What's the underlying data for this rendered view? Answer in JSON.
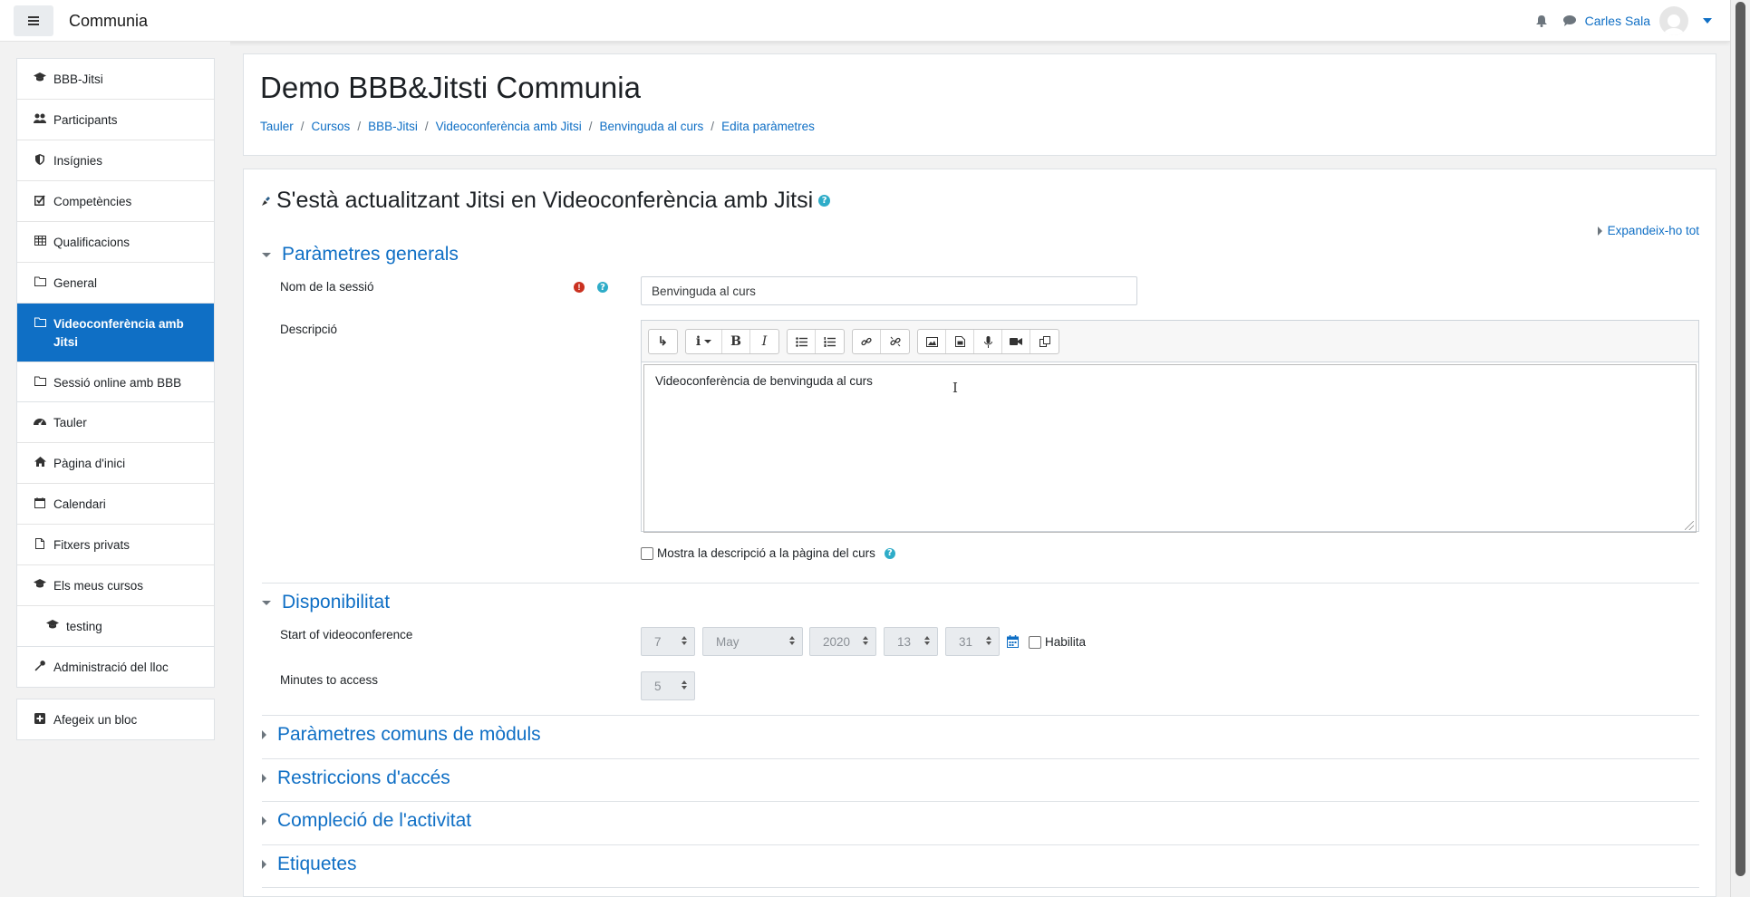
{
  "navbar": {
    "brand": "Communia",
    "user_name": "Carles Sala"
  },
  "drawer": {
    "course_nav": [
      {
        "label": "BBB-Jitsi",
        "icon": "graduation-cap-icon"
      },
      {
        "label": "Participants",
        "icon": "users-icon"
      },
      {
        "label": "Insígnies",
        "icon": "shield-icon"
      },
      {
        "label": "Competències",
        "icon": "checkbox-icon"
      },
      {
        "label": "Qualificacions",
        "icon": "table-icon"
      },
      {
        "label": "General",
        "icon": "folder-icon"
      },
      {
        "label": "Videoconferència amb Jitsi",
        "icon": "folder-icon",
        "active": true
      },
      {
        "label": "Sessió online amb BBB",
        "icon": "folder-icon"
      }
    ],
    "site_nav": [
      {
        "label": "Tauler",
        "icon": "dashboard-icon"
      },
      {
        "label": "Pàgina d'inici",
        "icon": "home-icon"
      },
      {
        "label": "Calendari",
        "icon": "calendar-icon"
      },
      {
        "label": "Fitxers privats",
        "icon": "file-icon"
      },
      {
        "label": "Els meus cursos",
        "icon": "graduation-cap-icon"
      },
      {
        "label": "testing",
        "icon": "graduation-cap-icon"
      }
    ],
    "admin": {
      "label": "Administració del lloc"
    },
    "add_block": {
      "label": "Afegeix un bloc"
    }
  },
  "header": {
    "title": "Demo BBB&Jitsti Communia",
    "breadcrumb": [
      "Tauler",
      "Cursos",
      "BBB-Jitsi",
      "Videoconferència amb Jitsi",
      "Benvinguda al curs",
      "Edita paràmetres"
    ]
  },
  "form": {
    "title": "S'està actualitzant Jitsi en Videoconferència amb Jitsi",
    "expand_all": "Expandeix-ho tot",
    "general": {
      "heading": "Paràmetres generals",
      "name_label": "Nom de la sessió",
      "name_value": "Benvinguda al curs",
      "desc_label": "Descripció",
      "desc_value": "Videoconferència de benvinguda al curs",
      "show_desc_label": "Mostra la descripció a la pàgina del curs"
    },
    "availability": {
      "heading": "Disponibilitat",
      "start_label": "Start of videoconference",
      "day": "7",
      "month": "May",
      "year": "2020",
      "hour": "13",
      "minute": "31",
      "enable_label": "Habilita",
      "minutes_label": "Minutes to access",
      "minutes_value": "5"
    },
    "collapsed_sections": [
      "Paràmetres comuns de mòduls",
      "Restriccions d'accés",
      "Compleció de l'activitat",
      "Etiquetes"
    ]
  },
  "colors": {
    "accent": "#0f6fc5",
    "required": "#ca3120",
    "help": "#2eacc8"
  }
}
